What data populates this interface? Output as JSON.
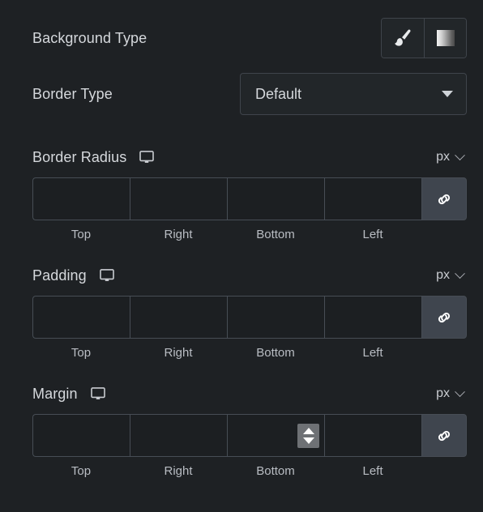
{
  "panel": {
    "background_color": "#1e2124",
    "accent_color": "#3f454e"
  },
  "background_type": {
    "label": "Background Type",
    "options": [
      {
        "name": "classic",
        "icon": "paintbrush-icon",
        "selected": false
      },
      {
        "name": "gradient",
        "icon": "gradient-icon",
        "selected": false
      }
    ]
  },
  "border_type": {
    "label": "Border Type",
    "value": "Default",
    "icon": "chevron-down-icon"
  },
  "border_radius": {
    "label": "Border Radius",
    "device_icon": "monitor-icon",
    "unit": "px",
    "unit_caret": "chevron-down-icon",
    "link_icon": "link-icon",
    "values": [
      "",
      "",
      "",
      ""
    ],
    "sublabels": [
      "Top",
      "Right",
      "Bottom",
      "Left"
    ],
    "placeholders": [
      "",
      "",
      "",
      ""
    ]
  },
  "padding": {
    "label": "Padding",
    "device_icon": "monitor-icon",
    "unit": "px",
    "unit_caret": "chevron-down-icon",
    "link_icon": "link-icon",
    "values": [
      "",
      "",
      "",
      ""
    ],
    "sublabels": [
      "Top",
      "Right",
      "Bottom",
      "Left"
    ],
    "placeholders": [
      "",
      "",
      "",
      ""
    ]
  },
  "margin": {
    "label": "Margin",
    "device_icon": "monitor-icon",
    "unit": "px",
    "unit_caret": "chevron-down-icon",
    "link_icon": "link-icon",
    "values": [
      "",
      "",
      "",
      ""
    ],
    "sublabels": [
      "Top",
      "Right",
      "Bottom",
      "Left"
    ],
    "placeholders": [
      "",
      "",
      "",
      ""
    ],
    "spinner_on_index": 2
  }
}
